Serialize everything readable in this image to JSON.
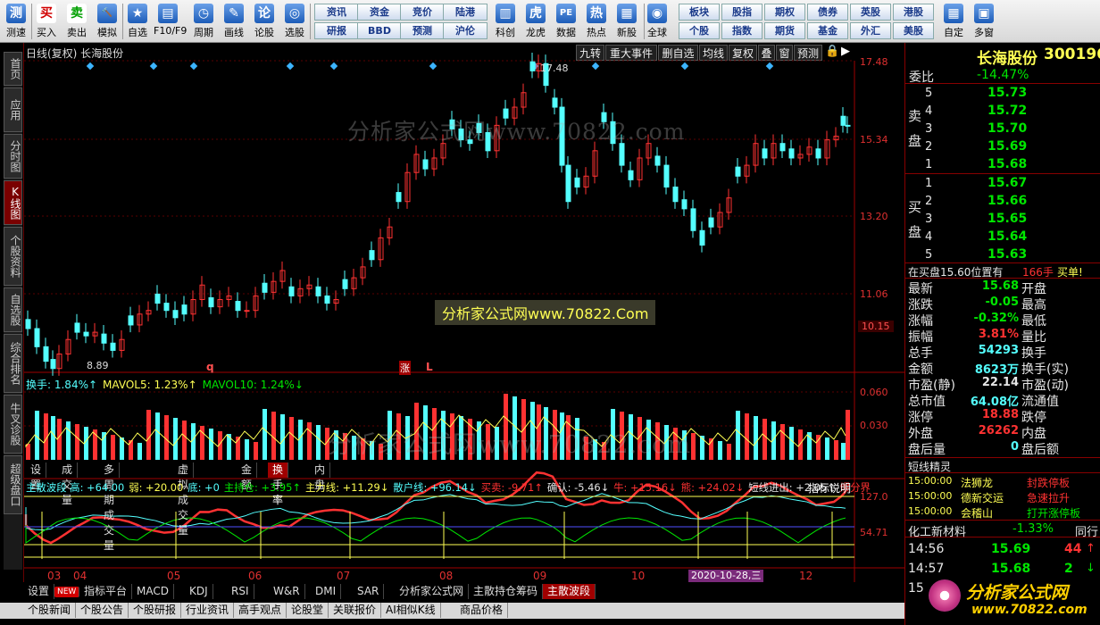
{
  "toolbar": {
    "items": [
      {
        "label": "测速",
        "icon": "测",
        "name": "speed-test"
      },
      {
        "label": "买入",
        "icon": "买",
        "name": "buy"
      },
      {
        "label": "卖出",
        "icon": "卖",
        "name": "sell"
      },
      {
        "label": "模拟",
        "icon": "🔨",
        "name": "simulate"
      },
      {
        "label": "自选",
        "icon": "★",
        "name": "watchlist"
      },
      {
        "label": "F10/F9",
        "icon": "▤",
        "name": "f10"
      },
      {
        "label": "周期",
        "icon": "◷",
        "name": "period"
      },
      {
        "label": "画线",
        "icon": "✎",
        "name": "draw-line"
      },
      {
        "label": "论股",
        "icon": "论",
        "name": "forum"
      },
      {
        "label": "选股",
        "icon": "◎",
        "name": "stock-picker"
      }
    ],
    "grid_buttons": [
      [
        "资讯",
        "资金",
        "竞价",
        "陆港"
      ],
      [
        "研报",
        "BBD",
        "预测",
        "沪伦"
      ]
    ],
    "items2": [
      {
        "label": "科创",
        "icon": "▥",
        "name": "star-market"
      },
      {
        "label": "龙虎",
        "icon": "虎",
        "name": "dragon-tiger"
      },
      {
        "label": "数据",
        "icon": "PE",
        "name": "data"
      },
      {
        "label": "热点",
        "icon": "热",
        "name": "hotspot"
      },
      {
        "label": "新股",
        "icon": "▦",
        "name": "new-stocks"
      },
      {
        "label": "全球",
        "icon": "◉",
        "name": "global"
      }
    ],
    "grid_buttons2": [
      [
        "板块",
        "股指",
        "期权",
        "债券",
        "英股",
        "港股"
      ],
      [
        "个股",
        "指数",
        "期货",
        "基金",
        "外汇",
        "美股"
      ]
    ],
    "items3": [
      {
        "label": "自定",
        "icon": "▦",
        "name": "customize"
      },
      {
        "label": "多窗",
        "icon": "▣",
        "name": "multi-window"
      }
    ]
  },
  "sidebar": [
    {
      "label": "首页",
      "active": false,
      "h": 38
    },
    {
      "label": "应用",
      "active": false,
      "h": 50
    },
    {
      "label": "分时图",
      "active": false,
      "h": 50
    },
    {
      "label": "K线图",
      "active": true,
      "h": 50
    },
    {
      "label": "个股资料",
      "active": false,
      "h": 66
    },
    {
      "label": "自选股",
      "active": false,
      "h": 50
    },
    {
      "label": "综合排名",
      "active": false,
      "h": 66
    },
    {
      "label": "牛叉诊股",
      "active": false,
      "h": 66
    },
    {
      "label": "超级盘口",
      "active": false,
      "h": 66
    }
  ],
  "chart_header": {
    "left": "日线(复权)  长海股份",
    "right_tabs": [
      "九转",
      "重大事件",
      "删自选",
      "均线",
      "复权",
      "叠",
      "窗",
      "预测"
    ]
  },
  "kline": {
    "ticks": [
      "17.48",
      "15.34",
      "13.20",
      "11.06"
    ],
    "current": "10.15",
    "high_label": "17.48",
    "low_label": "8.89",
    "markers": [
      "q",
      "涨",
      "L"
    ]
  },
  "watermarks": [
    "分析家公式网www.70822.com",
    "分析家公式网www.70822.Com",
    "分析家公式网www.70822.com"
  ],
  "volume": {
    "legend_parts": [
      {
        "t": "换手: 1.84%↑",
        "c": "c"
      },
      {
        "t": "MAVOL5: 1.23%↑",
        "c": "y"
      },
      {
        "t": "MAVOL10: 1.24%↓",
        "c": "g"
      }
    ],
    "ticks": [
      "0.060",
      "0.030"
    ]
  },
  "vol_tabs": [
    "设置",
    "成交量",
    "多周期成交量",
    "虚拟成交量",
    "金额",
    "换手率",
    "内盘"
  ],
  "indicator": {
    "legend": [
      {
        "t": "主散波段 高: +64.00",
        "c": "c"
      },
      {
        "t": "弱: +20.00",
        "c": "y"
      },
      {
        "t": "底: +0",
        "c": "c"
      },
      {
        "t": "主持仓: +3.95↑",
        "c": "g"
      },
      {
        "t": "主力线: +11.29↓",
        "c": "y"
      },
      {
        "t": "散户线: +96.14↓",
        "c": "c"
      },
      {
        "t": "买卖: -9.71↑",
        "c": "r"
      },
      {
        "t": "确认: -5.46↓",
        "c": "w"
      },
      {
        "t": "牛: +15.16↓",
        "c": "r"
      },
      {
        "t": "熊: +24.02↓",
        "c": "r"
      },
      {
        "t": "短线进出: +2.05↑",
        "c": "w"
      },
      {
        "t": "爆分界",
        "c": "r"
      }
    ],
    "explain": "指标说明",
    "ticks": [
      "127.0",
      "54.71"
    ]
  },
  "dates": [
    "03",
    "04",
    "05",
    "06",
    "07",
    "08",
    "09",
    "10",
    "11",
    "12"
  ],
  "date_cursor": "2020-10-28,三",
  "bottom_tabs": [
    "设置",
    "NEW",
    "指标平台",
    "MACD",
    "KDJ",
    "RSI",
    "W&R",
    "DMI",
    "SAR",
    "分析家公式网",
    "主散持仓筹码",
    "主散波段"
  ],
  "bottom_tabs2": [
    "个股新闻",
    "个股公告",
    "个股研报",
    "行业资讯",
    "高手观点",
    "论股堂",
    "关联报价",
    "AI相似K线",
    "商品价格"
  ],
  "quote": {
    "name": "长海股份",
    "code": "300196",
    "weibi_label": "委比",
    "weibi": "-14.47%",
    "sell_label": "卖盘",
    "buy_label": "买盘",
    "sell": [
      [
        "5",
        "15.73"
      ],
      [
        "4",
        "15.72"
      ],
      [
        "3",
        "15.70"
      ],
      [
        "2",
        "15.69"
      ],
      [
        "1",
        "15.68"
      ]
    ],
    "buy": [
      [
        "1",
        "15.67"
      ],
      [
        "2",
        "15.66"
      ],
      [
        "3",
        "15.65"
      ],
      [
        "4",
        "15.64"
      ],
      [
        "5",
        "15.63"
      ]
    ],
    "notice": [
      "在买盘15.60位置有",
      "166手",
      "买单!"
    ],
    "stats": [
      [
        "最新",
        "15.68",
        "开盘",
        ""
      ],
      [
        "涨跌",
        "-0.05",
        "最高",
        ""
      ],
      [
        "涨幅",
        "-0.32%",
        "最低",
        ""
      ],
      [
        "振幅",
        "3.81%",
        "量比",
        ""
      ],
      [
        "总手",
        "54293",
        "换手",
        ""
      ],
      [
        "金额",
        "8623万",
        "换手(实)",
        ""
      ],
      [
        "市盈(静)",
        "22.14",
        "市盈(动)",
        ""
      ],
      [
        "总市值",
        "64.08亿",
        "流通值",
        ""
      ],
      [
        "涨停",
        "18.88",
        "跌停",
        ""
      ],
      [
        "外盘",
        "26262",
        "内盘",
        ""
      ],
      [
        "盘后量",
        "0",
        "盘后额",
        ""
      ]
    ],
    "elf_title": "短线精灵",
    "elf": [
      [
        "15:00:00",
        "法狮龙",
        "封跌停板"
      ],
      [
        "15:00:00",
        "德新交运",
        "急速拉升"
      ],
      [
        "15:00:00",
        "会稽山",
        "打开涨停板"
      ]
    ],
    "sector_name": "化工新材料",
    "sector_chg": "-1.33%",
    "sector_right": "同行",
    "ticks": [
      [
        "14:56",
        "15.69",
        "44"
      ],
      [
        "14:57",
        "15.68",
        "2"
      ],
      [
        "15",
        "",
        " "
      ]
    ],
    "tick_dirs": [
      "↑",
      "↓",
      ""
    ],
    "logo_text": "分析家公式网",
    "logo_url": "www.70822.com"
  },
  "colors": {
    "up": "#ff3232",
    "down": "#54ffff",
    "ma5": "#ffff54",
    "ma10": "#00e600",
    "accent": "#a00000"
  }
}
